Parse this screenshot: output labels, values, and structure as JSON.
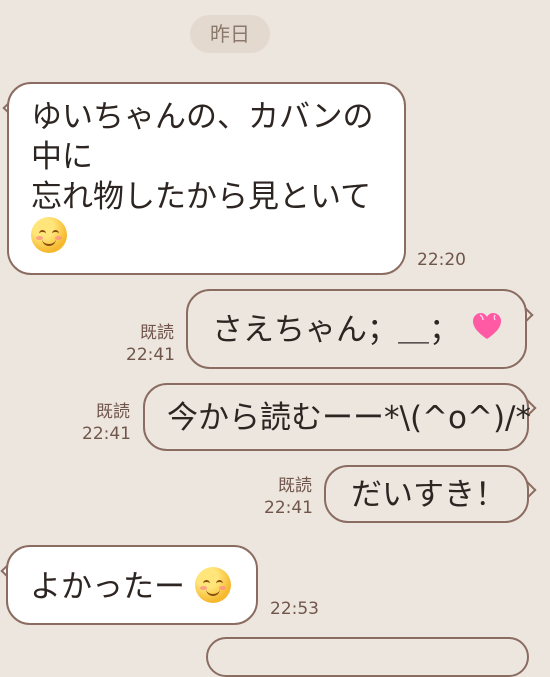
{
  "date_badge": "昨日",
  "messages": [
    {
      "direction": "incoming",
      "lines": [
        "ゆいちゃんの、カバンの",
        "中に",
        "忘れ物したから見といて"
      ],
      "emoji": "smiling-face-emoji",
      "time": "22:20"
    },
    {
      "direction": "outgoing",
      "text": "さえちゃん；＿；",
      "emoji": "pink-heart-emoji",
      "read_label": "既読",
      "time": "22:41"
    },
    {
      "direction": "outgoing",
      "text": "今から読むーー*\\(^o^)/*",
      "read_label": "既読",
      "time": "22:41"
    },
    {
      "direction": "outgoing",
      "text": "だいすき！",
      "read_label": "既読",
      "time": "22:41"
    },
    {
      "direction": "incoming",
      "text": "よかったー",
      "emoji": "smiling-face-emoji",
      "time": "22:53"
    }
  ],
  "colors": {
    "background": "#ede6df",
    "incoming_bubble": "#ffffff",
    "bubble_border": "#8a6c60",
    "meta_text": "#70564a"
  }
}
